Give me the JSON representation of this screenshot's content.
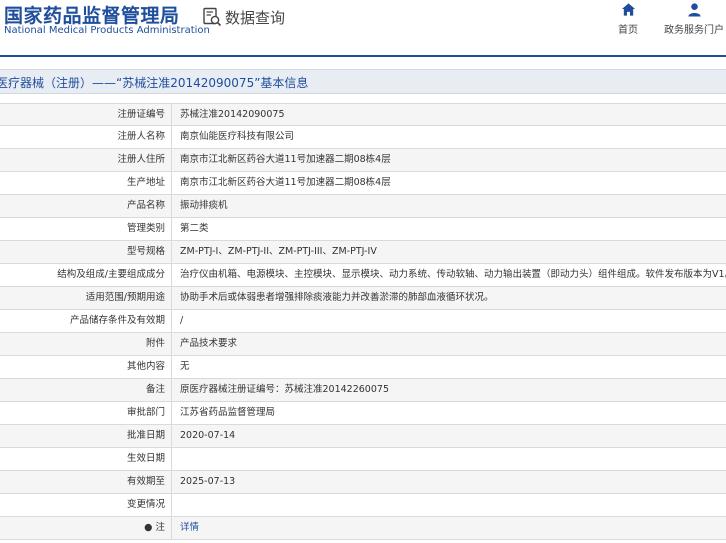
{
  "header": {
    "logo_cn": "国家药品监督管理局",
    "logo_en": "National Medical Products Administration",
    "query_label": "数据查询",
    "nav_home": "首页",
    "nav_portal": "政务服务门户"
  },
  "title": "医疗器械（注册）——“苏械注准20142090075”基本信息",
  "rows": [
    {
      "label": "注册证编号",
      "value": "苏械注准20142090075"
    },
    {
      "label": "注册人名称",
      "value": "南京仙能医疗科技有限公司"
    },
    {
      "label": "注册人住所",
      "value": "南京市江北新区药谷大道11号加速器二期08栋4层"
    },
    {
      "label": "生产地址",
      "value": "南京市江北新区药谷大道11号加速器二期08栋4层"
    },
    {
      "label": "产品名称",
      "value": "振动排痰机"
    },
    {
      "label": "管理类别",
      "value": "第二类"
    },
    {
      "label": "型号规格",
      "value": "ZM-PTJ-I、ZM-PTJ-II、ZM-PTJ-III、ZM-PTJ-IV"
    },
    {
      "label": "结构及组成/主要组成成分",
      "value": "治疗仪由机箱、电源模块、主控模块、显示模块、动力系统、传动软轴、动力输出装置（即动力头）组件组成。软件发布版本为V1。"
    },
    {
      "label": "适用范围/预期用途",
      "value": "协助手术后或体弱患者增强排除痰液能力并改善淤滞的肺部血液循环状况。"
    },
    {
      "label": "产品储存条件及有效期",
      "value": "/"
    },
    {
      "label": "附件",
      "value": "产品技术要求"
    },
    {
      "label": "其他内容",
      "value": "无"
    },
    {
      "label": "备注",
      "value": "原医疗器械注册证编号：苏械注准20142260075"
    },
    {
      "label": "审批部门",
      "value": "江苏省药品监督管理局"
    },
    {
      "label": "批准日期",
      "value": "2020-07-14"
    },
    {
      "label": "生效日期",
      "value": ""
    },
    {
      "label": "有效期至",
      "value": "2025-07-13"
    },
    {
      "label": "变更情况",
      "value": ""
    },
    {
      "label": "注",
      "value": "详情"
    }
  ],
  "colors": {
    "brand": "#1f4e9c",
    "row_alt": "#f5f5f5",
    "title_bg": "#e8ecf3"
  },
  "icons": {
    "query": "search-document-icon",
    "home": "home-icon",
    "portal": "user-icon",
    "note": "bullet-icon"
  }
}
